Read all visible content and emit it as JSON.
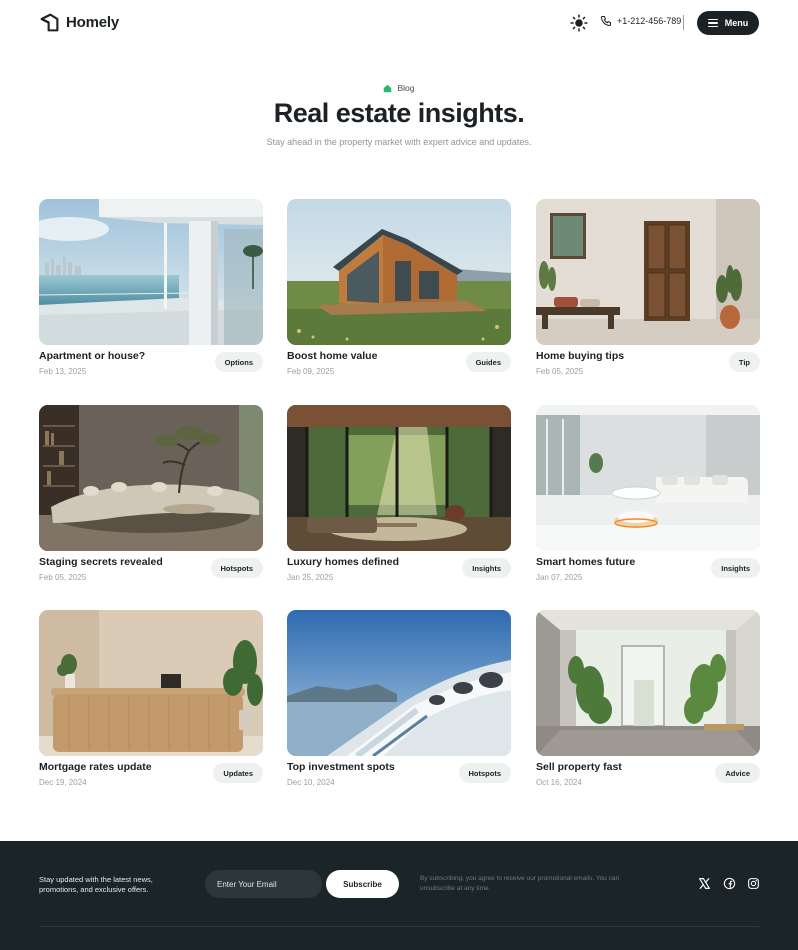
{
  "brand": {
    "name": "Homely"
  },
  "header": {
    "phone": "+1-212-456-789",
    "menu_label": "Menu"
  },
  "hero": {
    "eyebrow": "Blog",
    "title": "Real estate insights.",
    "subtitle": "Stay ahead in the property market with expert advice and updates."
  },
  "posts": [
    {
      "title": "Apartment or house?",
      "date": "Feb 13, 2025",
      "tag": "Options"
    },
    {
      "title": "Boost home value",
      "date": "Feb 09, 2025",
      "tag": "Guides"
    },
    {
      "title": "Home buying tips",
      "date": "Feb 05, 2025",
      "tag": "Tip"
    },
    {
      "title": "Staging secrets revealed",
      "date": "Feb 05, 2025",
      "tag": "Hotspots"
    },
    {
      "title": "Luxury homes defined",
      "date": "Jan 25, 2025",
      "tag": "Insights"
    },
    {
      "title": "Smart homes future",
      "date": "Jan 07, 2025",
      "tag": "Insights"
    },
    {
      "title": "Mortgage rates update",
      "date": "Dec 19, 2024",
      "tag": "Updates"
    },
    {
      "title": "Top investment spots",
      "date": "Dec 10, 2024",
      "tag": "Hotspots"
    },
    {
      "title": "Sell property fast",
      "date": "Oct 16, 2024",
      "tag": "Advice"
    }
  ],
  "footer": {
    "newsletter_text": "Stay updated with the latest news, promotions, and exclusive offers.",
    "email_placeholder": "Enter Your Email",
    "subscribe_label": "Subscribe",
    "note": "By subscribing, you agree to receive our promotional emails. You can unsubscribe at any time."
  },
  "colors": {
    "dark": "#1b2124",
    "footer_bg": "#1b2528",
    "accent_green": "#2bb673",
    "tag_bg": "#eff1f1"
  },
  "icons": [
    "house-logo-icon",
    "sun-icon",
    "phone-icon",
    "hamburger-icon",
    "home-icon",
    "x-icon",
    "facebook-icon",
    "instagram-icon"
  ]
}
